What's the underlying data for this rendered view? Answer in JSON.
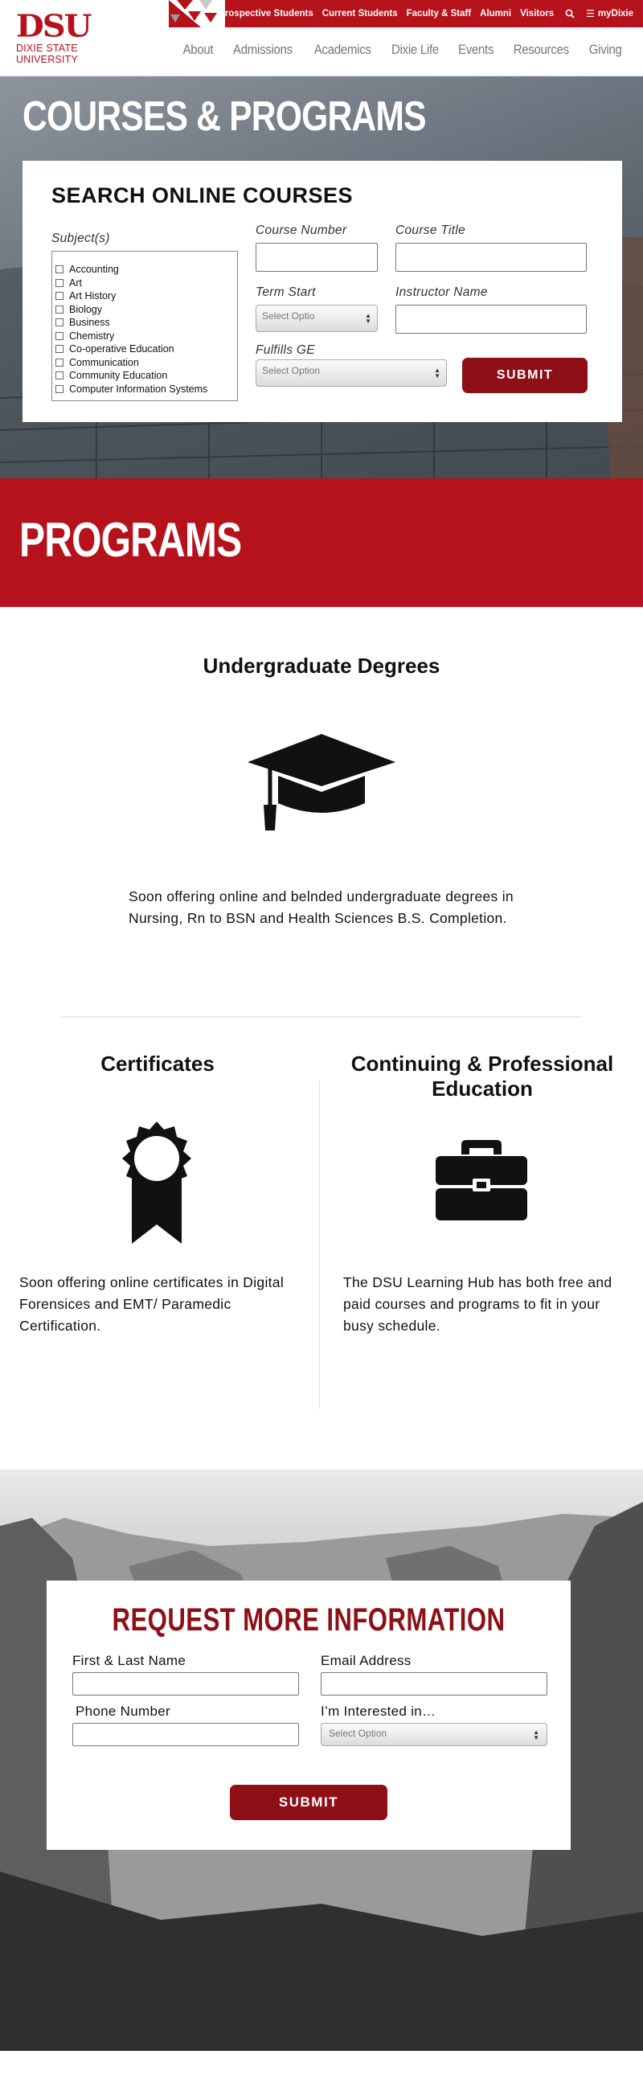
{
  "header": {
    "logo_mark": "DSU",
    "logo_sub": "Dixie State University",
    "top_links": [
      "Prospective Students",
      "Current Students",
      "Faculty & Staff",
      "Alumni",
      "Visitors"
    ],
    "mydixie_label": "myDixie",
    "nav": [
      "About",
      "Admissions",
      "Academics",
      "Dixie Life",
      "Events",
      "Resources",
      "Giving"
    ]
  },
  "hero": {
    "title": "COURSES & PROGRAMS",
    "search": {
      "heading": "SEARCH ONLINE COURSES",
      "subjects_label": "Subject(s)",
      "subjects": [
        "Accounting",
        "Art",
        "Art History",
        "Biology",
        "Business",
        "Chemistry",
        "Co-operative Education",
        "Communication",
        "Community Education",
        "Computer Information Systems"
      ],
      "course_number_label": "Course Number",
      "course_number_value": "",
      "course_title_label": "Course Title",
      "course_title_value": "",
      "term_start_label": "Term Start",
      "term_start_selected": "Select Optio",
      "instructor_label": "Instructor Name",
      "instructor_value": "",
      "ge_label": "Fulfills GE",
      "ge_selected": "Select Option",
      "submit_label": "SUBMIT"
    }
  },
  "programs": {
    "banner_title": "PROGRAMS",
    "undergrad": {
      "title": "Undergraduate Degrees",
      "icon": "graduation-cap-icon",
      "description": "Soon offering online and belnded undergraduate degrees in Nursing, Rn to BSN and Health Sciences B.S. Completion."
    },
    "certificates": {
      "title": "Certificates",
      "icon": "award-ribbon-icon",
      "description": "Soon offering online certificates in Digital Forensices and EMT/ Paramedic Certification."
    },
    "continuing": {
      "title": "Continuing & Professional Education",
      "icon": "briefcase-icon",
      "description": "The DSU Learning Hub has both free and paid courses and programs to fit in your busy schedule."
    }
  },
  "request_info": {
    "title": "REQUEST MORE INFORMATION",
    "name_label": "First & Last Name",
    "name_value": "",
    "email_label": "Email Address",
    "email_value": "",
    "phone_label": "Phone Number",
    "phone_value": "",
    "interest_label": "I’m Interested in…",
    "interest_selected": "Select Option",
    "submit_label": "SUBMIT"
  },
  "colors": {
    "brand_red": "#b5121b",
    "dark_red": "#8e1016"
  }
}
